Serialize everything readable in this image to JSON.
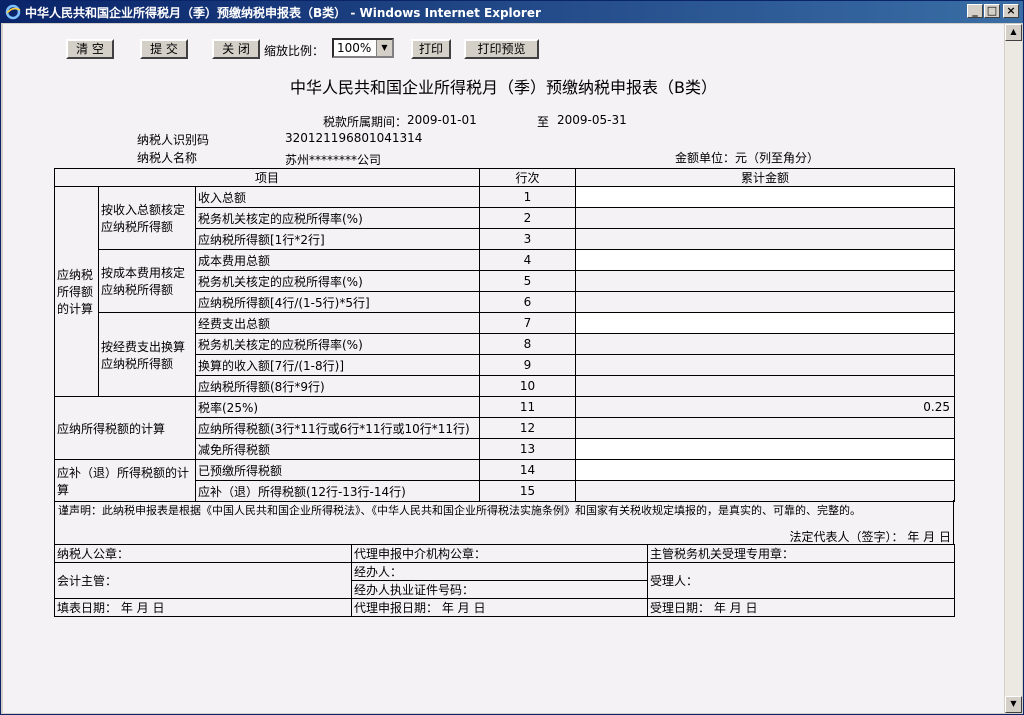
{
  "window": {
    "title": "中华人民共和国企业所得税月（季）预缴纳税申报表（B类） - Windows Internet Explorer",
    "minimize": "_",
    "maximize": "□",
    "close": "×"
  },
  "toolbar": {
    "clear": "清 空",
    "submit": "提 交",
    "close": "关 闭",
    "zoom_label": "缩放比例：",
    "zoom_value": "100%",
    "print": "打印",
    "print_preview": "打印预览"
  },
  "form": {
    "title": "中华人民共和国企业所得税月（季）预缴纳税申报表（B类）",
    "period_label": "税款所属期间：",
    "period_start": "2009-01-01",
    "period_to": "至",
    "period_end": "2009-05-31",
    "taxpayer_id_label": "纳税人识别码",
    "taxpayer_id": "320121196801041314",
    "taxpayer_name_label": "纳税人名称",
    "taxpayer_name": "苏州********公司",
    "unit_label": "金额单位：元（列至角分）"
  },
  "table": {
    "headers": {
      "item": "项目",
      "line": "行次",
      "amount": "累计金额"
    },
    "section1": "应纳税所得额的计算",
    "group1": "按收入总额核定应纳税所得额",
    "group2": "按成本费用核定应纳税所得额",
    "group3": "按经费支出换算应纳税所得额",
    "section2": "应纳所得税额的计算",
    "section3": "应补（退）所得税额的计算",
    "rows": [
      {
        "label": "收入总额",
        "line": "1",
        "value": ""
      },
      {
        "label": "税务机关核定的应税所得率(%)",
        "line": "2",
        "value": ""
      },
      {
        "label": "应纳税所得额[1行*2行]",
        "line": "3",
        "value": ""
      },
      {
        "label": "成本费用总额",
        "line": "4",
        "value": ""
      },
      {
        "label": "税务机关核定的应税所得率(%)",
        "line": "5",
        "value": ""
      },
      {
        "label": "应纳税所得额[4行/(1-5行)*5行]",
        "line": "6",
        "value": ""
      },
      {
        "label": "经费支出总额",
        "line": "7",
        "value": ""
      },
      {
        "label": "税务机关核定的应税所得率(%)",
        "line": "8",
        "value": ""
      },
      {
        "label": "换算的收入额[7行/(1-8行)]",
        "line": "9",
        "value": ""
      },
      {
        "label": "应纳税所得额(8行*9行)",
        "line": "10",
        "value": ""
      },
      {
        "label": "税率(25%)",
        "line": "11",
        "value": "0.25"
      },
      {
        "label": "应纳所得税额(3行*11行或6行*11行或10行*11行)",
        "line": "12",
        "value": ""
      },
      {
        "label": "减免所得税额",
        "line": "13",
        "value": ""
      },
      {
        "label": "已预缴所得税额",
        "line": "14",
        "value": ""
      },
      {
        "label": "应补（退）所得税额(12行-13行-14行)",
        "line": "15",
        "value": ""
      }
    ]
  },
  "declaration": {
    "text": "谨声明：此纳税申报表是根据《中国人民共和国企业所得税法》、《中华人民共和国企业所得税法实施条例》和国家有关税收规定填报的，是真实的、可靠的、完整的。",
    "signature": "法定代表人（签字）：  年  月  日"
  },
  "footer": {
    "taxpayer_seal": "纳税人公章：",
    "agency_seal": "代理申报中介机构公章：",
    "tax_office_seal": "主管税务机关受理专用章：",
    "accountant": "会计主管：",
    "handler": "经办人：",
    "handler_cert": "经办人执业证件号码：",
    "receiver": "受理人：",
    "fill_date": "填表日期：  年  月  日",
    "agency_date": "代理申报日期：  年  月  日",
    "accept_date": "受理日期：  年  月  日"
  }
}
